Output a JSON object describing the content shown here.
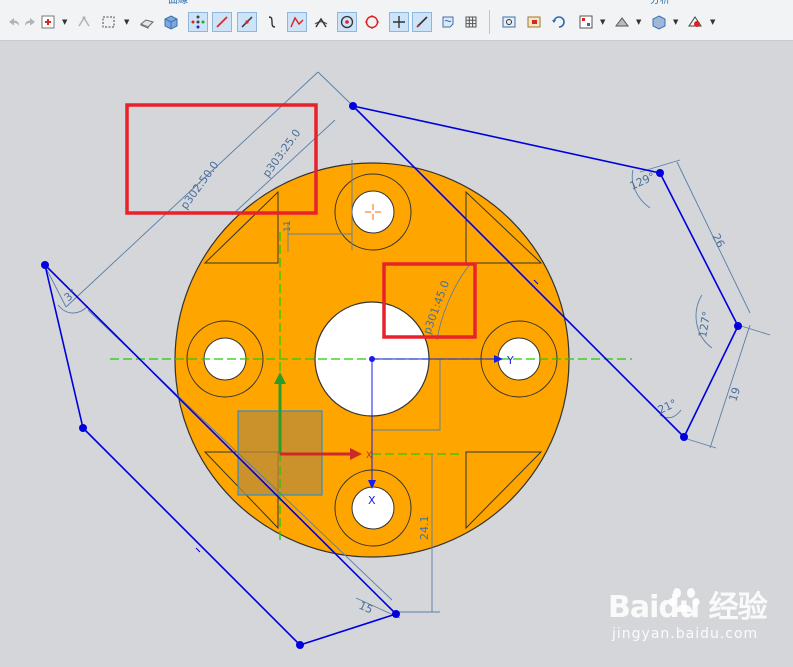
{
  "toolbar": {
    "header_fragment_left": "曲線",
    "header_fragment_right": "分析",
    "tools": [
      {
        "name": "undo-icon"
      },
      {
        "name": "redo-icon"
      },
      {
        "name": "snap-point-icon"
      },
      {
        "name": "transform-icon"
      },
      {
        "name": "select-box-icon"
      },
      {
        "name": "render-style-icon"
      },
      {
        "name": "solid-view-icon"
      },
      {
        "name": "show-constraints-icon"
      },
      {
        "name": "line-tool-icon"
      },
      {
        "name": "profile-tool-icon"
      },
      {
        "name": "arc-tool-icon"
      },
      {
        "name": "studio-spline-icon"
      },
      {
        "name": "angle-constraint-icon"
      },
      {
        "name": "point-on-curve-icon"
      },
      {
        "name": "circle-icon"
      },
      {
        "name": "fix-icon"
      },
      {
        "name": "line-constraint-icon"
      },
      {
        "name": "edit-section-icon"
      },
      {
        "name": "grid-icon"
      },
      {
        "name": "fit-view-icon"
      },
      {
        "name": "zoom-window-icon"
      },
      {
        "name": "rotate-icon"
      },
      {
        "name": "layer-settings-icon"
      },
      {
        "name": "section-view-icon"
      },
      {
        "name": "model-view-icon"
      },
      {
        "name": "selection-filter-icon"
      }
    ]
  },
  "sketch": {
    "dimensions": {
      "p302": "p302:50.0",
      "p303": "p303:25.0",
      "p301": "p301:45.0",
      "angle_129": "129°",
      "length_26": "26",
      "angle_127": "127°",
      "length_19": "19",
      "angle_21": "21°",
      "angle_3": "3°",
      "dim_24_1": "24.1",
      "dim_15": "15",
      "dim_11": "11"
    },
    "axis_labels": {
      "y_axis": "Y",
      "x_axis_main": "X",
      "x_axis_bottom": "X"
    },
    "colors": {
      "part_fill": "#ffa500",
      "sketch_curve": "#0000dd",
      "dimension": "#5a7ea8",
      "centerline": "#22cc00",
      "highlight_box": "#e8212a",
      "background": "#d4d6d9"
    }
  },
  "watermark": {
    "brand": "Baidu 经验",
    "url": "jingyan.baidu.com"
  }
}
